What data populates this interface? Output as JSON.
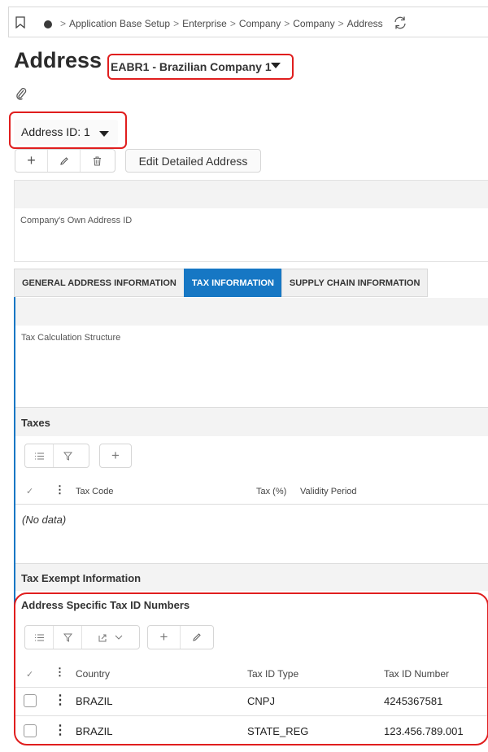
{
  "breadcrumb": {
    "items": [
      "Application Base Setup",
      "Enterprise",
      "Company",
      "Company",
      "Address"
    ],
    "separator": ">"
  },
  "page": {
    "title": "Address",
    "company_selector": "EABR1 - Brazilian Company 1",
    "address_selector": "Address ID: 1"
  },
  "toolbar": {
    "edit_detailed_address": "Edit Detailed Address"
  },
  "own_address": {
    "label": "Company's Own Address ID"
  },
  "tabs": [
    {
      "label": "GENERAL ADDRESS INFORMATION",
      "active": false
    },
    {
      "label": "TAX INFORMATION",
      "active": true
    },
    {
      "label": "SUPPLY CHAIN INFORMATION",
      "active": false
    }
  ],
  "tax_calc": {
    "label": "Tax Calculation Structure"
  },
  "taxes": {
    "title": "Taxes",
    "columns": [
      "Tax Code",
      "Tax (%)",
      "Validity Period"
    ],
    "empty_text": "(No data)"
  },
  "tax_exempt": {
    "title": "Tax Exempt Information"
  },
  "tax_ids": {
    "title": "Address Specific Tax ID Numbers",
    "columns": [
      "Country",
      "Tax ID Type",
      "Tax ID Number"
    ],
    "rows": [
      {
        "country": "BRAZIL",
        "type": "CNPJ",
        "number": "4245367581"
      },
      {
        "country": "BRAZIL",
        "type": "STATE_REG",
        "number": "123.456.789.001"
      }
    ]
  },
  "colors": {
    "accent": "#1677c4",
    "highlight": "#e01e1e"
  }
}
